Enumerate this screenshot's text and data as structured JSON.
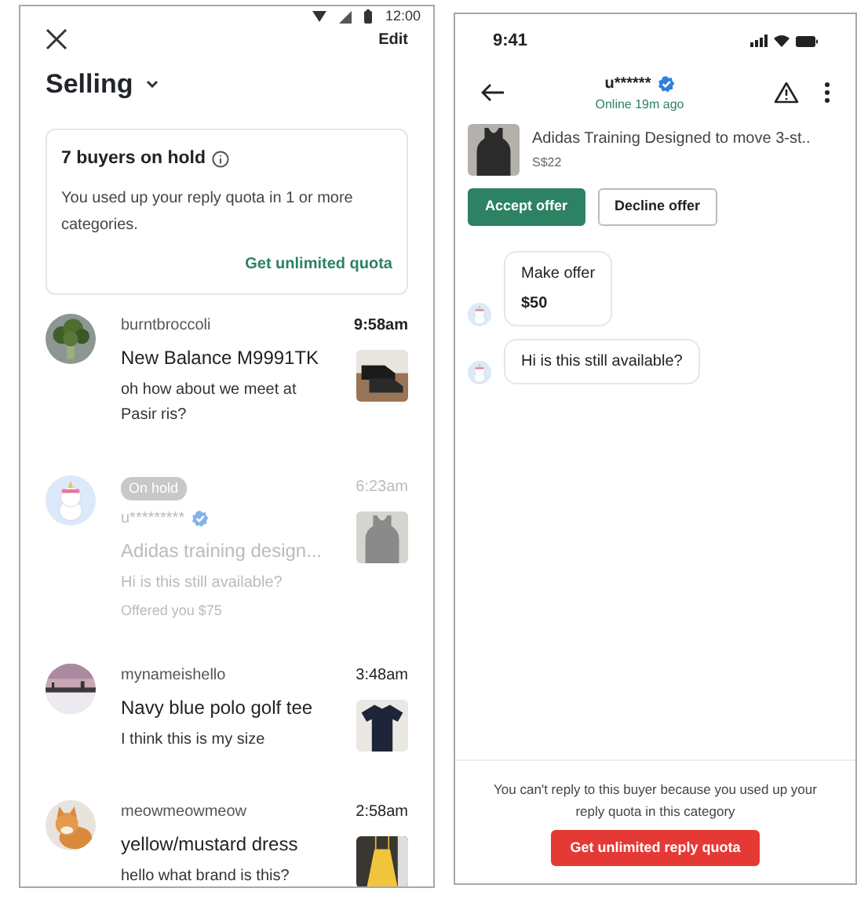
{
  "inbox": {
    "status_bar": {
      "time": "12:00"
    },
    "edit": "Edit",
    "title": "Selling",
    "notice": {
      "title": "7 buyers on hold",
      "body": "You used up your reply quota in 1 or more categories.",
      "link": "Get unlimited quota"
    },
    "conversations": [
      {
        "user": "burntbroccoli",
        "verified": false,
        "on_hold": false,
        "unread": true,
        "time": "9:58am",
        "title": "New Balance M9991TK",
        "message": "oh how about we meet at Pasir ris?"
      },
      {
        "user": "u*********",
        "verified": true,
        "on_hold": true,
        "hold_label": "On hold",
        "unread": false,
        "time": "6:23am",
        "title": "Adidas training design...",
        "message": "Hi is this still available?",
        "offer": "Offered you $75"
      },
      {
        "user": "mynameishello",
        "verified": false,
        "on_hold": false,
        "unread": false,
        "time": "3:48am",
        "title": "Navy blue polo golf tee",
        "message": "I think this is my size"
      },
      {
        "user": "meowmeowmeow",
        "verified": false,
        "on_hold": false,
        "unread": false,
        "time": "2:58am",
        "title": "yellow/mustard dress",
        "message": "hello what brand is this?"
      }
    ]
  },
  "chat": {
    "status_bar": {
      "time": "9:41"
    },
    "user": "u******",
    "verified": true,
    "presence": "Online 19m ago",
    "product": {
      "title": "Adidas Training Designed to move 3-st..",
      "price": "S$22"
    },
    "actions": [
      {
        "label": "Accept offer",
        "kind": "primary"
      },
      {
        "label": "Decline offer",
        "kind": "outline"
      }
    ],
    "messages": [
      {
        "kind": "offer",
        "label": "Make offer",
        "amount": "$50"
      },
      {
        "kind": "text",
        "text": "Hi is this still available?"
      }
    ],
    "footer": {
      "text": "You can't reply to this buyer because you used up your reply quota in this category",
      "button": "Get unlimited reply quota"
    }
  }
}
